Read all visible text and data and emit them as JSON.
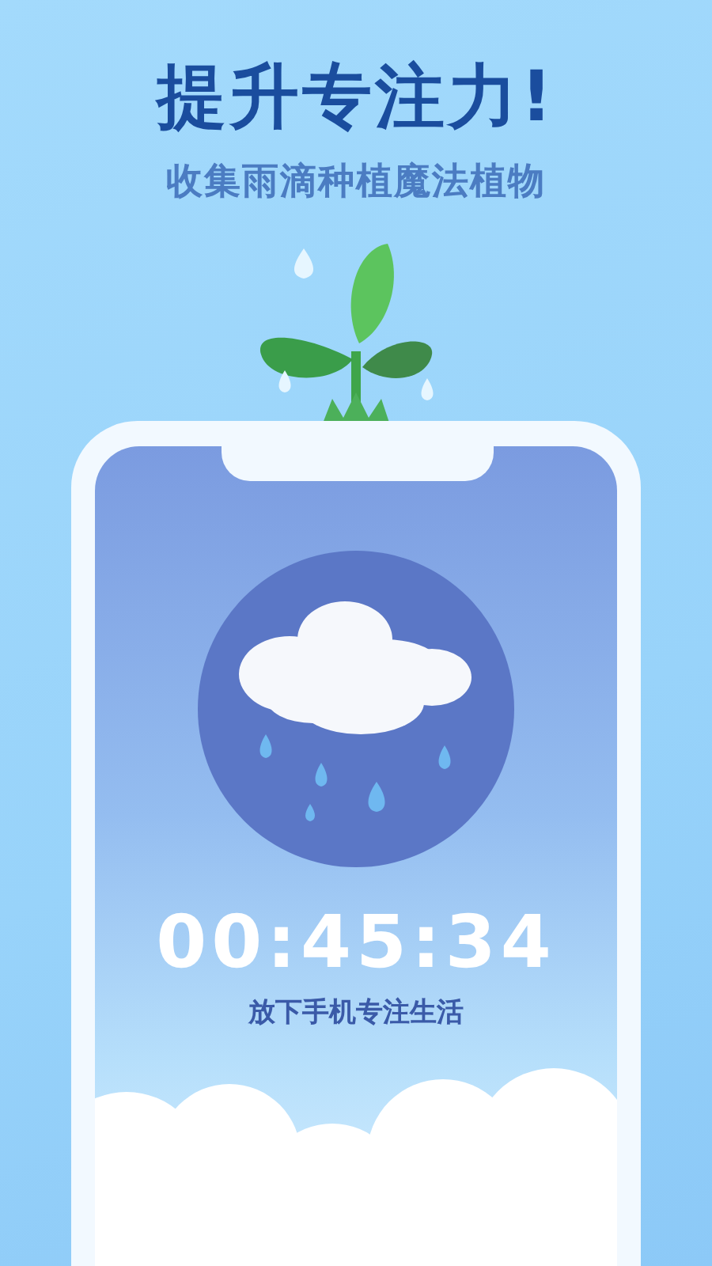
{
  "headline": "提升专注力!",
  "subheadline": "收集雨滴种植魔法植物",
  "timer": {
    "time": "00:45:34",
    "caption": "放下手机专注生活"
  }
}
